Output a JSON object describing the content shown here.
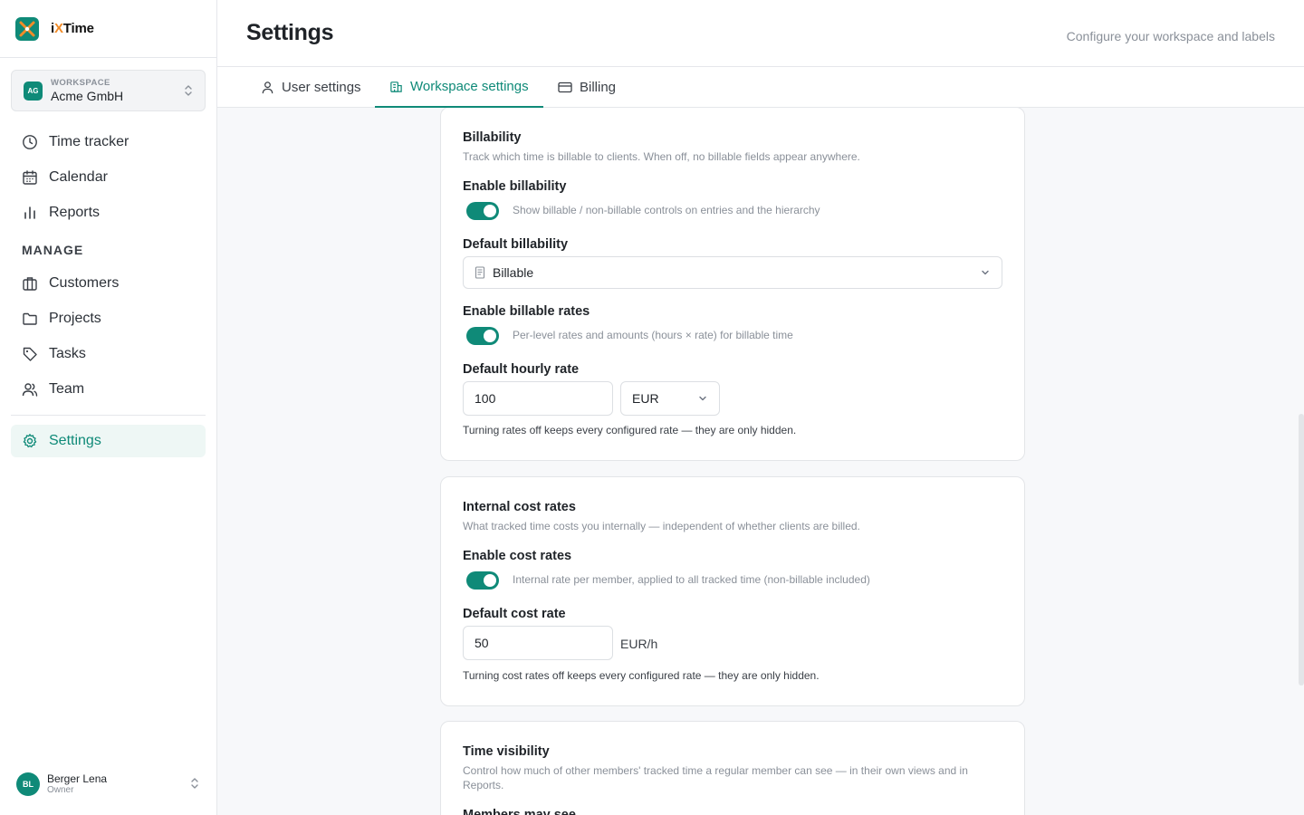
{
  "app": {
    "name_prefix": "i",
    "name_x": "X",
    "name_suffix": "Time"
  },
  "workspace": {
    "caption": "WORKSPACE",
    "initials": "AG",
    "name": "Acme GmbH"
  },
  "nav": {
    "main": [
      {
        "label": "Time tracker",
        "icon": "clock-icon"
      },
      {
        "label": "Calendar",
        "icon": "calendar-icon"
      },
      {
        "label": "Reports",
        "icon": "bar-chart-icon"
      }
    ],
    "manage_heading": "MANAGE",
    "manage": [
      {
        "label": "Customers",
        "icon": "briefcase-icon"
      },
      {
        "label": "Projects",
        "icon": "folder-icon"
      },
      {
        "label": "Tasks",
        "icon": "tag-icon"
      },
      {
        "label": "Team",
        "icon": "users-icon"
      }
    ],
    "settings": {
      "label": "Settings",
      "icon": "gear-icon",
      "active": true
    }
  },
  "user": {
    "initials": "BL",
    "name": "Berger Lena",
    "role": "Owner"
  },
  "header": {
    "title": "Settings",
    "subtitle": "Configure your workspace and labels"
  },
  "tabs": [
    {
      "label": "User settings",
      "icon": "user-icon",
      "active": false
    },
    {
      "label": "Workspace settings",
      "icon": "building-icon",
      "active": true
    },
    {
      "label": "Billing",
      "icon": "credit-card-icon",
      "active": false
    }
  ],
  "billability": {
    "title": "Billability",
    "description": "Track which time is billable to clients. When off, no billable fields appear anywhere.",
    "enable_label": "Enable billability",
    "enable_on": true,
    "enable_desc": "Show billable / non-billable controls on entries and the hierarchy",
    "default_label": "Default billability",
    "default_value": "Billable",
    "rates_label": "Enable billable rates",
    "rates_on": true,
    "rates_desc": "Per-level rates and amounts (hours × rate) for billable time",
    "hourly_label": "Default hourly rate",
    "hourly_value": "100",
    "currency": "EUR",
    "help": "Turning rates off keeps every configured rate — they are only hidden."
  },
  "cost_rates": {
    "title": "Internal cost rates",
    "description": "What tracked time costs you internally — independent of whether clients are billed.",
    "enable_label": "Enable cost rates",
    "enable_on": true,
    "enable_desc": "Internal rate per member, applied to all tracked time (non-billable included)",
    "default_label": "Default cost rate",
    "default_value": "50",
    "unit": "EUR/h",
    "help": "Turning cost rates off keeps every configured rate — they are only hidden."
  },
  "visibility": {
    "title": "Time visibility",
    "description": "Control how much of other members' tracked time a regular member can see — in their own views and in Reports.",
    "members_label": "Members may see"
  },
  "colors": {
    "accent": "#0f8a78",
    "brand_orange": "#f28c28"
  }
}
